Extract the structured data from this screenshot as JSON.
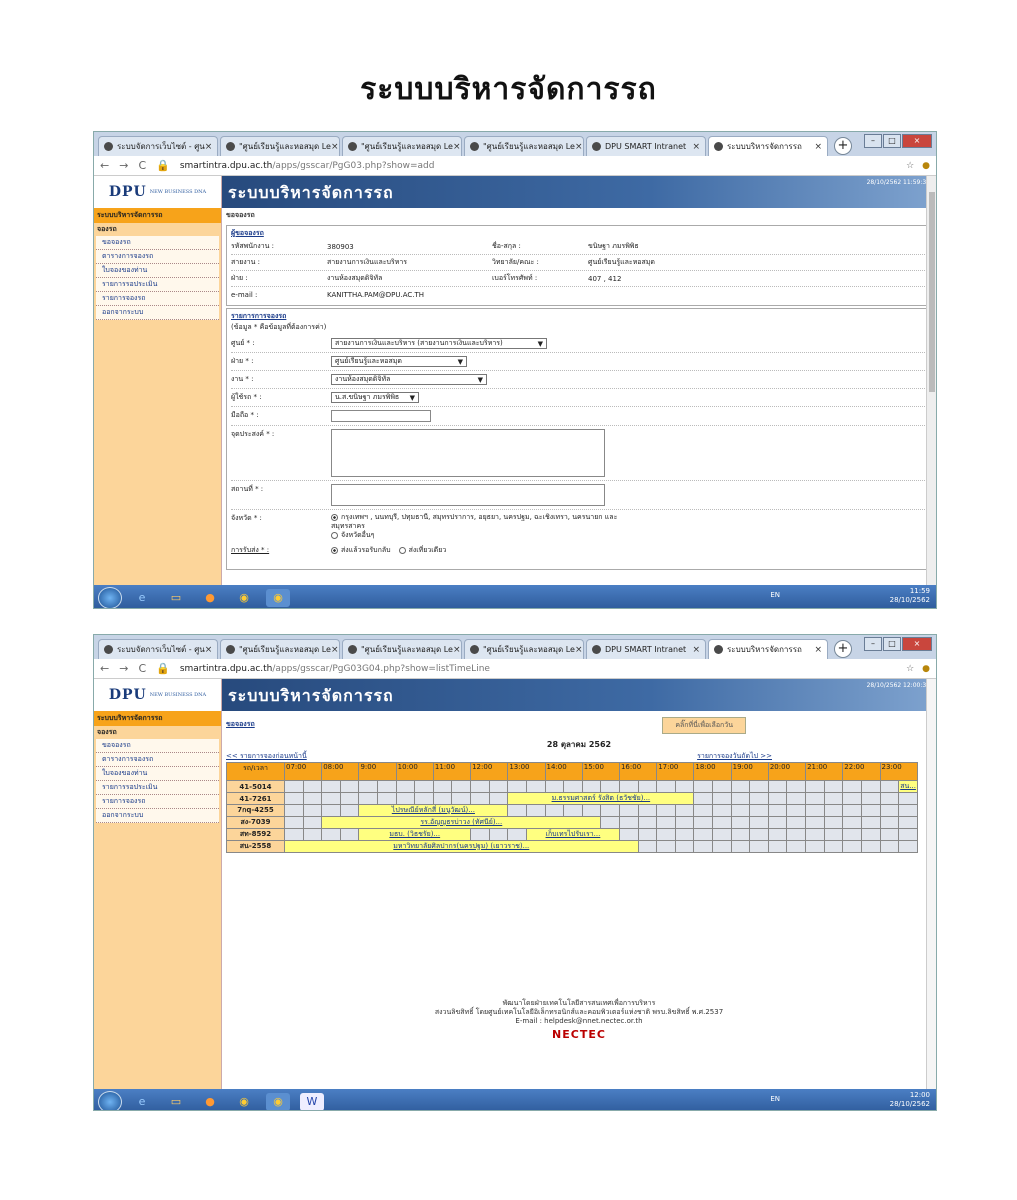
{
  "doc_title": "ระบบบริหารจัดการรถ",
  "tabs": [
    {
      "label": "ระบบจัดการเว็บไซต์ - ศูน"
    },
    {
      "label": "\"ศูนย์เรียนรู้และหอสมุด Le"
    },
    {
      "label": "\"ศูนย์เรียนรู้และหอสมุด Le"
    },
    {
      "label": "\"ศูนย์เรียนรู้และหอสมุด Le"
    },
    {
      "label": "DPU SMART Intranet"
    },
    {
      "label": "ระบบบริหารจัดการรถ"
    }
  ],
  "screen1": {
    "url_host": "smartintra.dpu.ac.th",
    "url_path": "/apps/gsscar/PgG03.php?show=add",
    "datetime": "28/10/2562  11:59:30",
    "crumb": "ขอจองรถ",
    "requester_legend": "ผู้ขอจองรถ",
    "requester": {
      "emp_id_label": "รหัสพนักงาน :",
      "emp_id": "380903",
      "name_label": "ชื่อ-สกุล :",
      "name": "ขนิษฐา ภมรพิพิธ",
      "line_label": "สายงาน :",
      "line": "สายงานการเงินและบริหาร",
      "college_label": "วิทยาลัย/คณะ :",
      "college": "ศูนย์เรียนรู้และหอสมุด",
      "dept_label": "ฝ่าย :",
      "dept": "งานห้องสมุดดิจิทัล",
      "phone_label": "เบอร์โทรศัพท์ :",
      "phone": "407 , 412",
      "email_label": "e-mail :",
      "email": "KANITTHA.PAM@DPU.AC.TH"
    },
    "booking_legend": "รายการการจองรถ",
    "required_note": "(ข้อมูล * คือข้อมูลที่ต้องการค่า)",
    "form": {
      "center_label": "ศูนย์ * :",
      "center_value": "สายงานการเงินและบริหาร (สายงานการเงินและบริหาร)",
      "dept_label": "ฝ่าย * :",
      "dept_value": "ศูนย์เรียนรู้และหอสมุด",
      "work_label": "งาน * :",
      "work_value": "งานห้องสมุดดิจิทัล",
      "user_label": "ผู้ใช้รถ * :",
      "user_value": "น.ส.ขนิษฐา ภมรพิพิธ",
      "mobile_label": "มือถือ * :",
      "purpose_label": "จุดประสงค์ * :",
      "place_label": "สถานที่ * :",
      "province_label": "จังหวัด * :",
      "province_opt1": "กรุงเทพฯ , นนทบุรี, ปทุมธานี, สมุทรปราการ, อยุธยา, นครปฐม, ฉะเชิงเทรา, นครนายก และ สมุทรสาคร",
      "province_opt2": "จังหวัดอื่นๆ",
      "deliver_label": "การรับส่ง * :",
      "deliver_opt1": "ส่งแล้วรอรับกลับ",
      "deliver_opt2": "ส่งเที่ยวเดียว"
    },
    "taskbar_time": "11:59",
    "taskbar_date": "28/10/2562"
  },
  "screen2": {
    "url_host": "smartintra.dpu.ac.th",
    "url_path": "/apps/gsscar/PgG03G04.php?show=listTimeLine",
    "datetime": "28/10/2562  12:00:30",
    "crumb": "ขอจองรถ",
    "pick_button": "คลิ๊กที่นี่เพื่อเลือกวัน",
    "date_title": "28 ตุลาคม 2562",
    "prev_link": "<< รายการจองก่อนหน้านี้",
    "next_link": "รายการจองวันถัดไป >>",
    "corner_header": "รถ/เวลา",
    "hours": [
      "07:00",
      "08:00",
      "9:00",
      "10:00",
      "11:00",
      "12:00",
      "13:00",
      "14:00",
      "15:00",
      "16:00",
      "17:00",
      "18:00",
      "19:00",
      "20:00",
      "21:00",
      "22:00",
      "23:00"
    ],
    "vehicles": [
      {
        "plate": "41-5014",
        "booking": "สน..."
      },
      {
        "plate": "41-7261",
        "booking": "ม.ธรรมศาสตร์ รังสิต (ธวัชชัย)..."
      },
      {
        "plate": "7กq-4255",
        "booking": "ไปรษณีย์หลักสี่ (มนูวัฒน์)..."
      },
      {
        "plate": "สง-7039",
        "booking": "รร.อัญญธรบ่าวง (ทัศนีย์)..."
      },
      {
        "plate": "สท-8592",
        "booking": "มธบ. (วิธชรัย)...",
        "booking2": "เก็บเทรไปรับเรา..."
      },
      {
        "plate": "สน-2558",
        "booking": "มหาวิทยาลัยศิลปากร(นครปฐม) (เยาวราช)..."
      }
    ],
    "footer_line1": "พัฒนาโดยฝ่ายเทคโนโลยีสารสนเทศเพื่อการบริหาร",
    "footer_line2": "สงวนลิขสิทธิ์ โดยศูนย์เทคโนโลยีอิเล็กทรอนิกส์และคอมพิวเตอร์แห่งชาติ พรบ.ลิขสิทธิ์ พ.ศ.2537",
    "footer_email": "E-mail : helpdesk@nnet.nectec.or.th",
    "nectec": "NECTEC",
    "taskbar_time": "12:00",
    "taskbar_date": "28/10/2562"
  },
  "sidebar": {
    "head": "ระบบบริหารจัดการรถ",
    "group": "จองรถ",
    "items": [
      "ขอจองรถ",
      "ตารางการจองรถ",
      "ใบจองของท่าน",
      "รายการรอประเมิน",
      "รายการจองรถ",
      "ออกจากระบบ"
    ]
  },
  "brand": {
    "logo": "DPU",
    "tagline": "NEW BUSINESS DNA",
    "system": "ระบบบริหารจัดการรถ"
  },
  "lang": "EN"
}
